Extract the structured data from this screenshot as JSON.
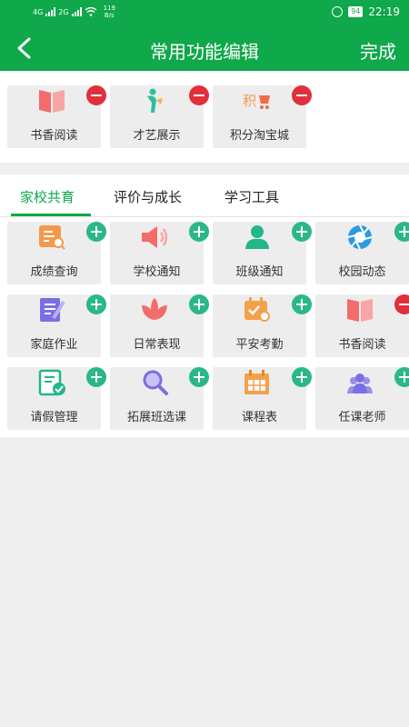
{
  "status_bar": {
    "network_left": "4G",
    "network_right": "2G",
    "speed_value": "119",
    "speed_unit": "B/s",
    "battery": "94",
    "time": "22:19"
  },
  "header": {
    "title": "常用功能编辑",
    "done_label": "完成"
  },
  "selected": [
    {
      "label": "书香阅读",
      "icon": "book-icon",
      "color": "#f36b6b"
    },
    {
      "label": "才艺展示",
      "icon": "talent-icon",
      "color": "#2bbfa0"
    },
    {
      "label": "积分淘宝城",
      "icon": "points-shop-icon",
      "color": "#f39a4a"
    }
  ],
  "tabs": [
    {
      "label": "家校共育",
      "active": true
    },
    {
      "label": "评价与成长",
      "active": false
    },
    {
      "label": "学习工具",
      "active": false
    }
  ],
  "functions": [
    {
      "label": "成绩查询",
      "icon": "grade-icon",
      "action": "add"
    },
    {
      "label": "学校通知",
      "icon": "speaker-icon",
      "action": "add"
    },
    {
      "label": "班级通知",
      "icon": "person-icon",
      "action": "add"
    },
    {
      "label": "校园动态",
      "icon": "aperture-icon",
      "action": "add"
    },
    {
      "label": "家庭作业",
      "icon": "homework-icon",
      "action": "add"
    },
    {
      "label": "日常表现",
      "icon": "lotus-icon",
      "action": "add"
    },
    {
      "label": "平安考勤",
      "icon": "attendance-icon",
      "action": "add"
    },
    {
      "label": "书香阅读",
      "icon": "book-icon",
      "action": "remove"
    },
    {
      "label": "请假管理",
      "icon": "leave-icon",
      "action": "add"
    },
    {
      "label": "拓展班选课",
      "icon": "search-icon",
      "action": "add"
    },
    {
      "label": "课程表",
      "icon": "calendar-icon",
      "action": "add"
    },
    {
      "label": "任课老师",
      "icon": "teachers-icon",
      "action": "add"
    }
  ],
  "colors": {
    "brand_green": "#0fa84a",
    "add_badge": "#2ab78a",
    "remove_badge": "#e0303c"
  }
}
